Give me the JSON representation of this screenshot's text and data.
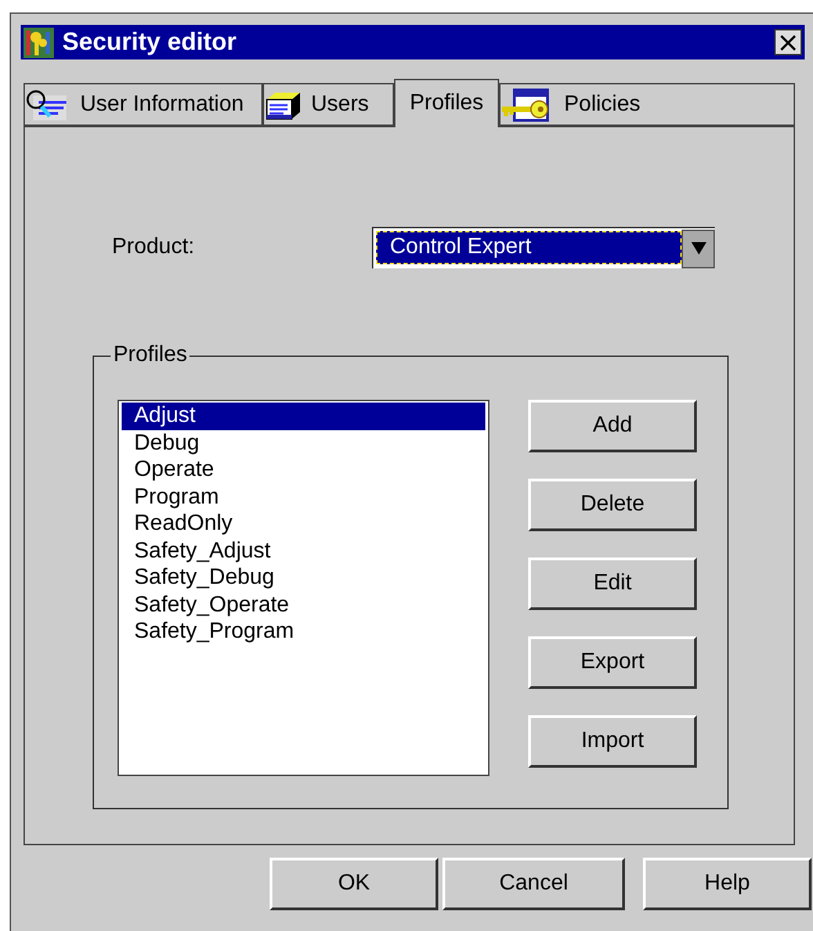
{
  "window": {
    "title": "Security editor"
  },
  "tabs": [
    {
      "label": "User Information",
      "selected": false
    },
    {
      "label": "Users",
      "selected": false
    },
    {
      "label": "Profiles",
      "selected": true
    },
    {
      "label": "Policies",
      "selected": false
    }
  ],
  "product": {
    "label": "Product:",
    "value": "Control Expert"
  },
  "profiles_group": {
    "title": "Profiles",
    "items": [
      {
        "label": "Adjust",
        "selected": true
      },
      {
        "label": "Debug",
        "selected": false
      },
      {
        "label": "Operate",
        "selected": false
      },
      {
        "label": "Program",
        "selected": false
      },
      {
        "label": "ReadOnly",
        "selected": false
      },
      {
        "label": "Safety_Adjust",
        "selected": false
      },
      {
        "label": "Safety_Debug",
        "selected": false
      },
      {
        "label": "Safety_Operate",
        "selected": false
      },
      {
        "label": "Safety_Program",
        "selected": false
      }
    ],
    "buttons": [
      "Add",
      "Delete",
      "Edit",
      "Export",
      "Import"
    ]
  },
  "buttons": [
    "OK",
    "Cancel",
    "Help"
  ]
}
